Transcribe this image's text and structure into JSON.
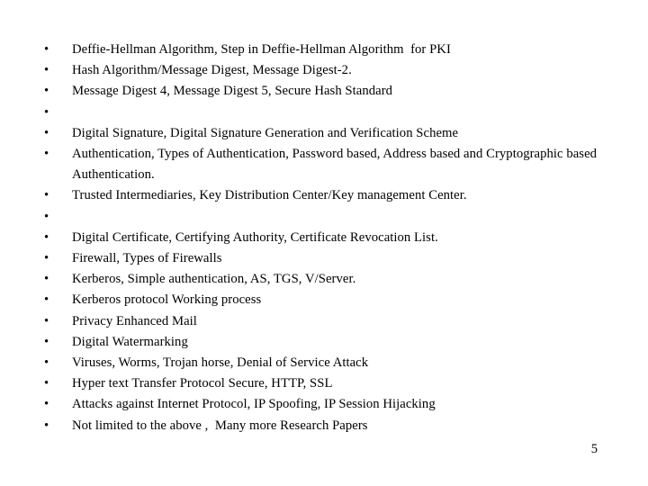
{
  "slide": {
    "background_color": "#ffffff",
    "text_color": "#000000",
    "bullet_marker": "•",
    "page_number": "5",
    "bullets": [
      {
        "text": "Deffie-Hellman Algorithm, Step in Deffie-Hellman Algorithm  for PKI"
      },
      {
        "text": "Hash Algorithm/Message Digest, Message Digest-2."
      },
      {
        "text": "Message Digest 4, Message Digest 5, Secure Hash Standard"
      },
      {
        "text": ""
      },
      {
        "text": "Digital Signature, Digital Signature Generation and Verification Scheme"
      },
      {
        "text": "Authentication, Types of Authentication, Password based, Address based and Cryptographic based  Authentication."
      },
      {
        "text": "Trusted Intermediaries, Key Distribution Center/Key management Center."
      },
      {
        "text": ""
      },
      {
        "text": "Digital Certificate, Certifying Authority, Certificate Revocation List."
      },
      {
        "text": "Firewall, Types of Firewalls"
      },
      {
        "text": "Kerberos, Simple authentication, AS, TGS, V/Server."
      },
      {
        "text": "Kerberos protocol Working process"
      },
      {
        "text": "Privacy Enhanced Mail"
      },
      {
        "text": "Digital Watermarking"
      },
      {
        "text": "Viruses, Worms, Trojan horse, Denial of Service Attack"
      },
      {
        "text": "Hyper text Transfer Protocol Secure, HTTP, SSL"
      },
      {
        "text": "Attacks against Internet Protocol, IP Spoofing, IP Session Hijacking"
      },
      {
        "text": "Not limited to the above ,  Many more Research Papers"
      }
    ]
  }
}
